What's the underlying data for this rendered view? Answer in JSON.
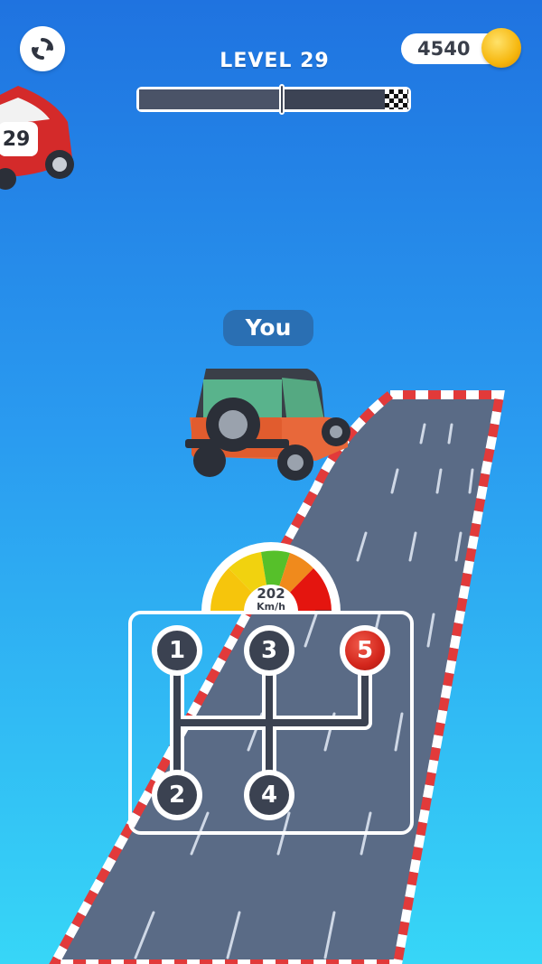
{
  "hud": {
    "level_label": "LEVEL 29",
    "coins": "4540",
    "progress_fraction": 0.53
  },
  "player_label": "You",
  "opponent_car_number": "29",
  "speedometer": {
    "value": "202",
    "unit": "Km/h"
  },
  "gearbox": {
    "gears": [
      "1",
      "3",
      "5",
      "2",
      "4"
    ],
    "current_gear": "5"
  },
  "colors": {
    "sky_top": "#1f73e0",
    "sky_bottom": "#37d6f7",
    "road": "#5a6b86",
    "active_gear": "#d3261c",
    "gear_knob": "#3b4251",
    "coin": "#f6b70f"
  },
  "icons": [
    "restart-icon",
    "coin-icon",
    "checkered-flag-icon"
  ]
}
